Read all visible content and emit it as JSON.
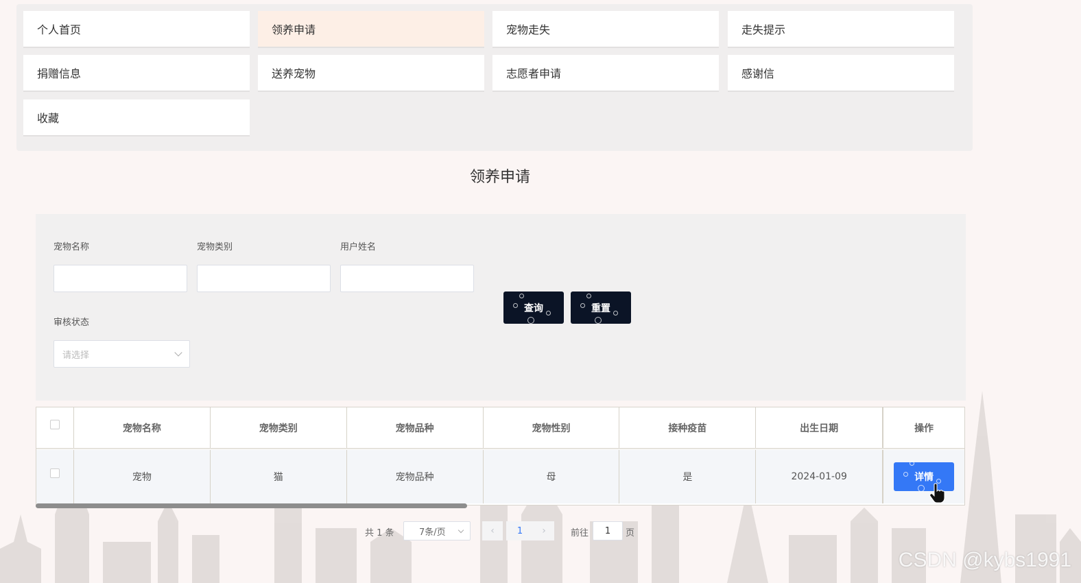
{
  "nav": {
    "items": [
      {
        "label": "个人首页",
        "active": false
      },
      {
        "label": "领养申请",
        "active": true
      },
      {
        "label": "宠物走失",
        "active": false
      },
      {
        "label": "走失提示",
        "active": false
      },
      {
        "label": "捐赠信息",
        "active": false
      },
      {
        "label": "送养宠物",
        "active": false
      },
      {
        "label": "志愿者申请",
        "active": false
      },
      {
        "label": "感谢信",
        "active": false
      },
      {
        "label": "收藏",
        "active": false
      }
    ]
  },
  "page": {
    "title": "领养申请"
  },
  "search": {
    "pet_name_label": "宠物名称",
    "pet_category_label": "宠物类别",
    "user_name_label": "用户姓名",
    "review_status_label": "审核状态",
    "review_status_placeholder": "请选择",
    "query_label": "查询",
    "reset_label": "重置"
  },
  "table": {
    "columns": [
      "宠物名称",
      "宠物类别",
      "宠物品种",
      "宠物性别",
      "接种疫苗",
      "出生日期",
      "操作"
    ],
    "rows": [
      {
        "pet_name": "宠物",
        "category": "猫",
        "breed": "宠物品种",
        "gender": "母",
        "vaccinated": "是",
        "birth_date": "2024-01-09",
        "action": "详情"
      }
    ]
  },
  "pagination": {
    "total_text": "共 1 条",
    "page_size": "7条/页",
    "current_page": "1",
    "goto_prefix": "前往",
    "goto_value": "1",
    "goto_suffix": "页"
  },
  "watermark": "CSDN @kybs1991",
  "colors": {
    "accent": "#3478f6",
    "dark_button": "#0b1426",
    "active_nav": "#fdefe6"
  }
}
